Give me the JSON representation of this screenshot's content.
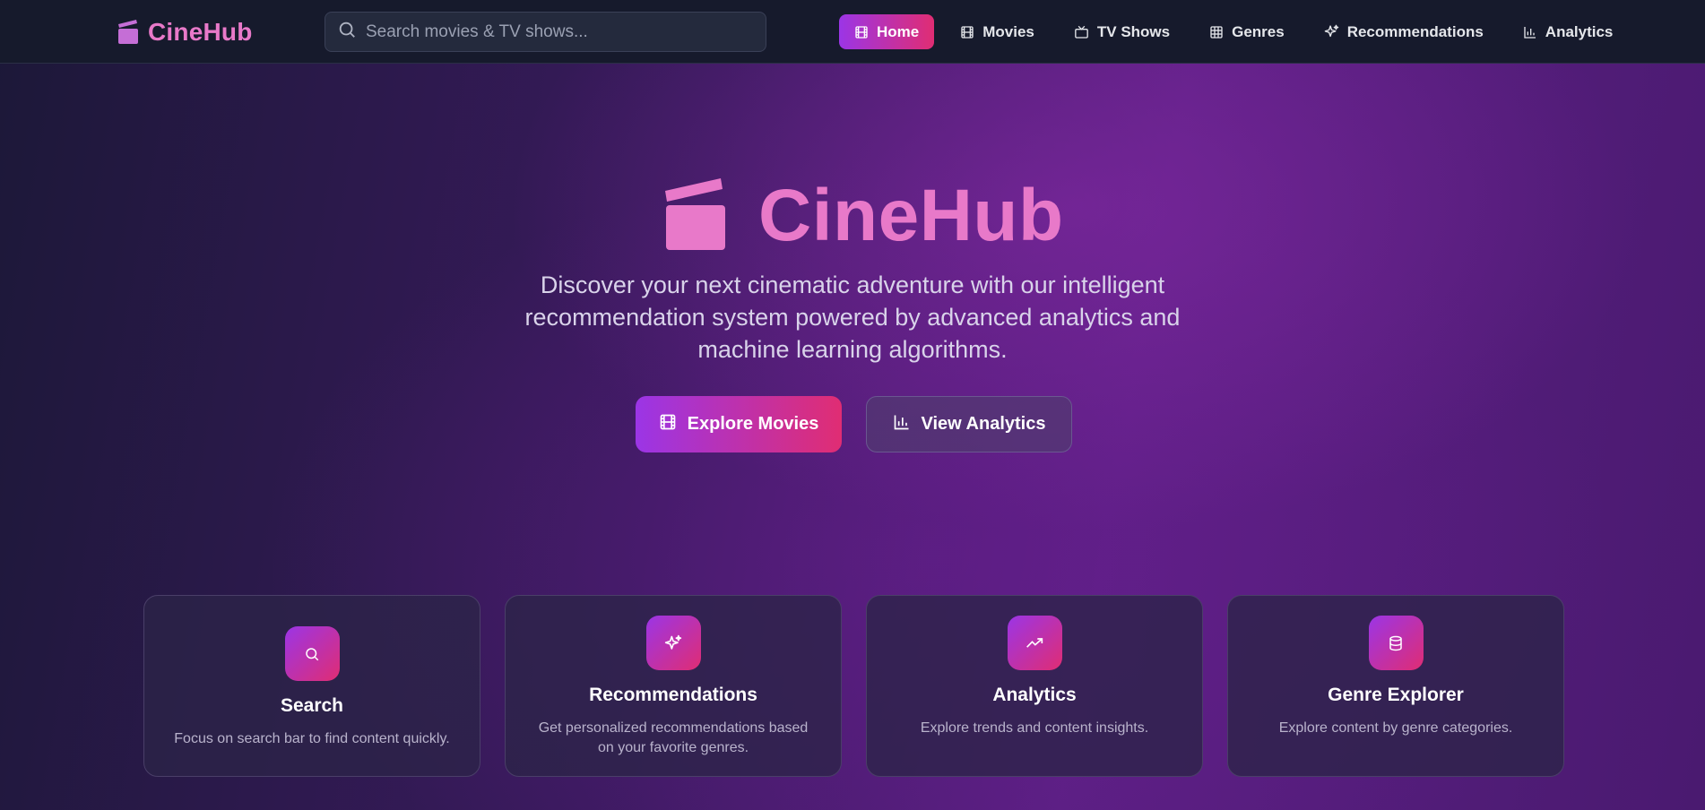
{
  "header": {
    "brand": "CineHub",
    "search_placeholder": "Search movies & TV shows...",
    "nav": [
      {
        "label": "Home",
        "icon": "film-icon",
        "active": true
      },
      {
        "label": "Movies",
        "icon": "film-icon"
      },
      {
        "label": "TV Shows",
        "icon": "tv-icon"
      },
      {
        "label": "Genres",
        "icon": "grid-icon"
      },
      {
        "label": "Recommendations",
        "icon": "sparkles-icon"
      },
      {
        "label": "Analytics",
        "icon": "bar-chart-icon"
      }
    ]
  },
  "hero": {
    "title": "CineHub",
    "description": "Discover your next cinematic adventure with our intelligent recommendation system powered by advanced analytics and machine learning algorithms.",
    "primary_button": "Explore Movies",
    "secondary_button": "View Analytics"
  },
  "cards": [
    {
      "title": "Search",
      "description": "Focus on search bar to find content quickly.",
      "icon": "search-icon"
    },
    {
      "title": "Recommendations",
      "description": "Get personalized recommendations based on your favorite genres.",
      "icon": "sparkles-icon"
    },
    {
      "title": "Analytics",
      "description": "Explore trends and content insights.",
      "icon": "trending-up-icon"
    },
    {
      "title": "Genre Explorer",
      "description": "Explore content by genre categories.",
      "icon": "database-icon"
    }
  ],
  "colors": {
    "accent_gradient_start": "#9b35e6",
    "accent_gradient_end": "#e02d73",
    "brand_pink": "#e879c9",
    "header_bg": "#161a2c"
  }
}
